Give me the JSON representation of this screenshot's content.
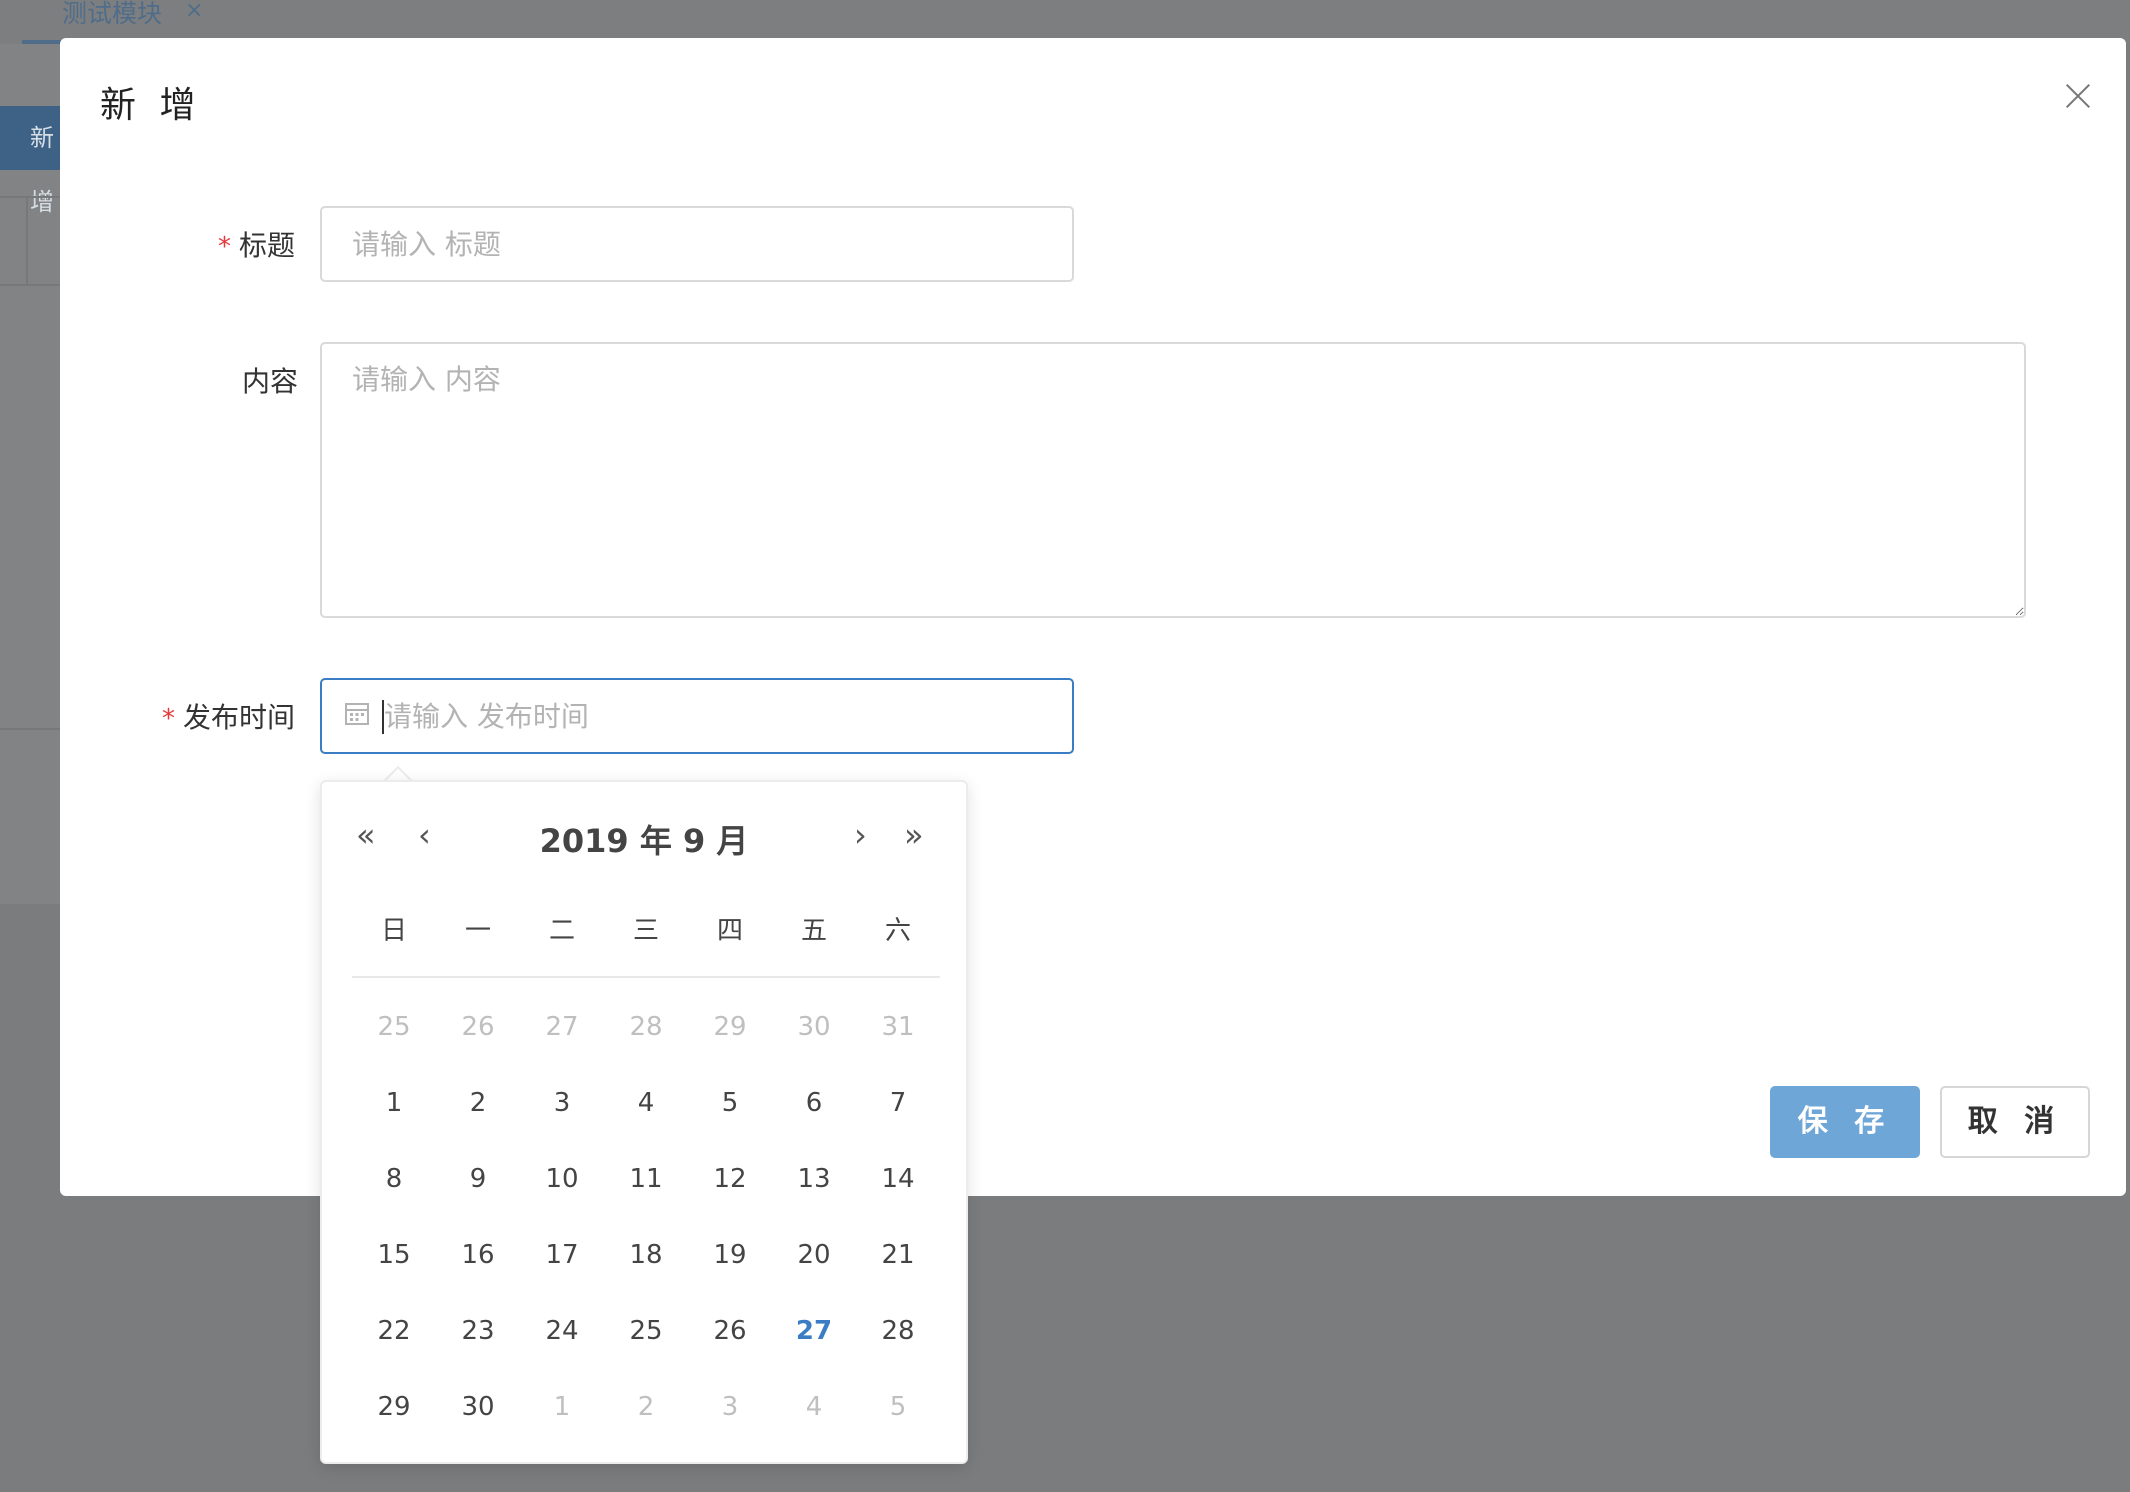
{
  "background": {
    "tab_label": "测试模块",
    "tab_close": "×",
    "add_button_label": "新 增"
  },
  "modal": {
    "title": "新 增",
    "fields": {
      "title": {
        "label": "标题",
        "required_mark": "*",
        "placeholder": "请输入 标题",
        "value": ""
      },
      "content": {
        "label": "内容",
        "placeholder": "请输入 内容",
        "value": ""
      },
      "publish_time": {
        "label": "发布时间",
        "required_mark": "*",
        "placeholder": "请输入 发布时间",
        "value": ""
      }
    },
    "buttons": {
      "save": "保 存",
      "cancel": "取 消"
    }
  },
  "datepicker": {
    "nav": {
      "prev_year": "«",
      "prev_month": "‹",
      "next_month": "›",
      "next_year": "»"
    },
    "header": "2019 年  9 月",
    "weekdays": [
      "日",
      "一",
      "二",
      "三",
      "四",
      "五",
      "六"
    ],
    "weeks": [
      [
        {
          "d": "25",
          "m": true
        },
        {
          "d": "26",
          "m": true
        },
        {
          "d": "27",
          "m": true
        },
        {
          "d": "28",
          "m": true
        },
        {
          "d": "29",
          "m": true
        },
        {
          "d": "30",
          "m": true
        },
        {
          "d": "31",
          "m": true
        }
      ],
      [
        {
          "d": "1"
        },
        {
          "d": "2"
        },
        {
          "d": "3"
        },
        {
          "d": "4"
        },
        {
          "d": "5"
        },
        {
          "d": "6"
        },
        {
          "d": "7"
        }
      ],
      [
        {
          "d": "8"
        },
        {
          "d": "9"
        },
        {
          "d": "10"
        },
        {
          "d": "11"
        },
        {
          "d": "12"
        },
        {
          "d": "13"
        },
        {
          "d": "14"
        }
      ],
      [
        {
          "d": "15"
        },
        {
          "d": "16"
        },
        {
          "d": "17"
        },
        {
          "d": "18"
        },
        {
          "d": "19"
        },
        {
          "d": "20"
        },
        {
          "d": "21"
        }
      ],
      [
        {
          "d": "22"
        },
        {
          "d": "23"
        },
        {
          "d": "24"
        },
        {
          "d": "25"
        },
        {
          "d": "26"
        },
        {
          "d": "27",
          "today": true
        },
        {
          "d": "28"
        }
      ],
      [
        {
          "d": "29"
        },
        {
          "d": "30"
        },
        {
          "d": "1",
          "m": true
        },
        {
          "d": "2",
          "m": true
        },
        {
          "d": "3",
          "m": true
        },
        {
          "d": "4",
          "m": true
        },
        {
          "d": "5",
          "m": true
        }
      ]
    ]
  },
  "colors": {
    "primary": "#6fa6d8",
    "focus": "#3b7dc4",
    "required": "#e4393c",
    "overlay": "#7b7c7e"
  }
}
